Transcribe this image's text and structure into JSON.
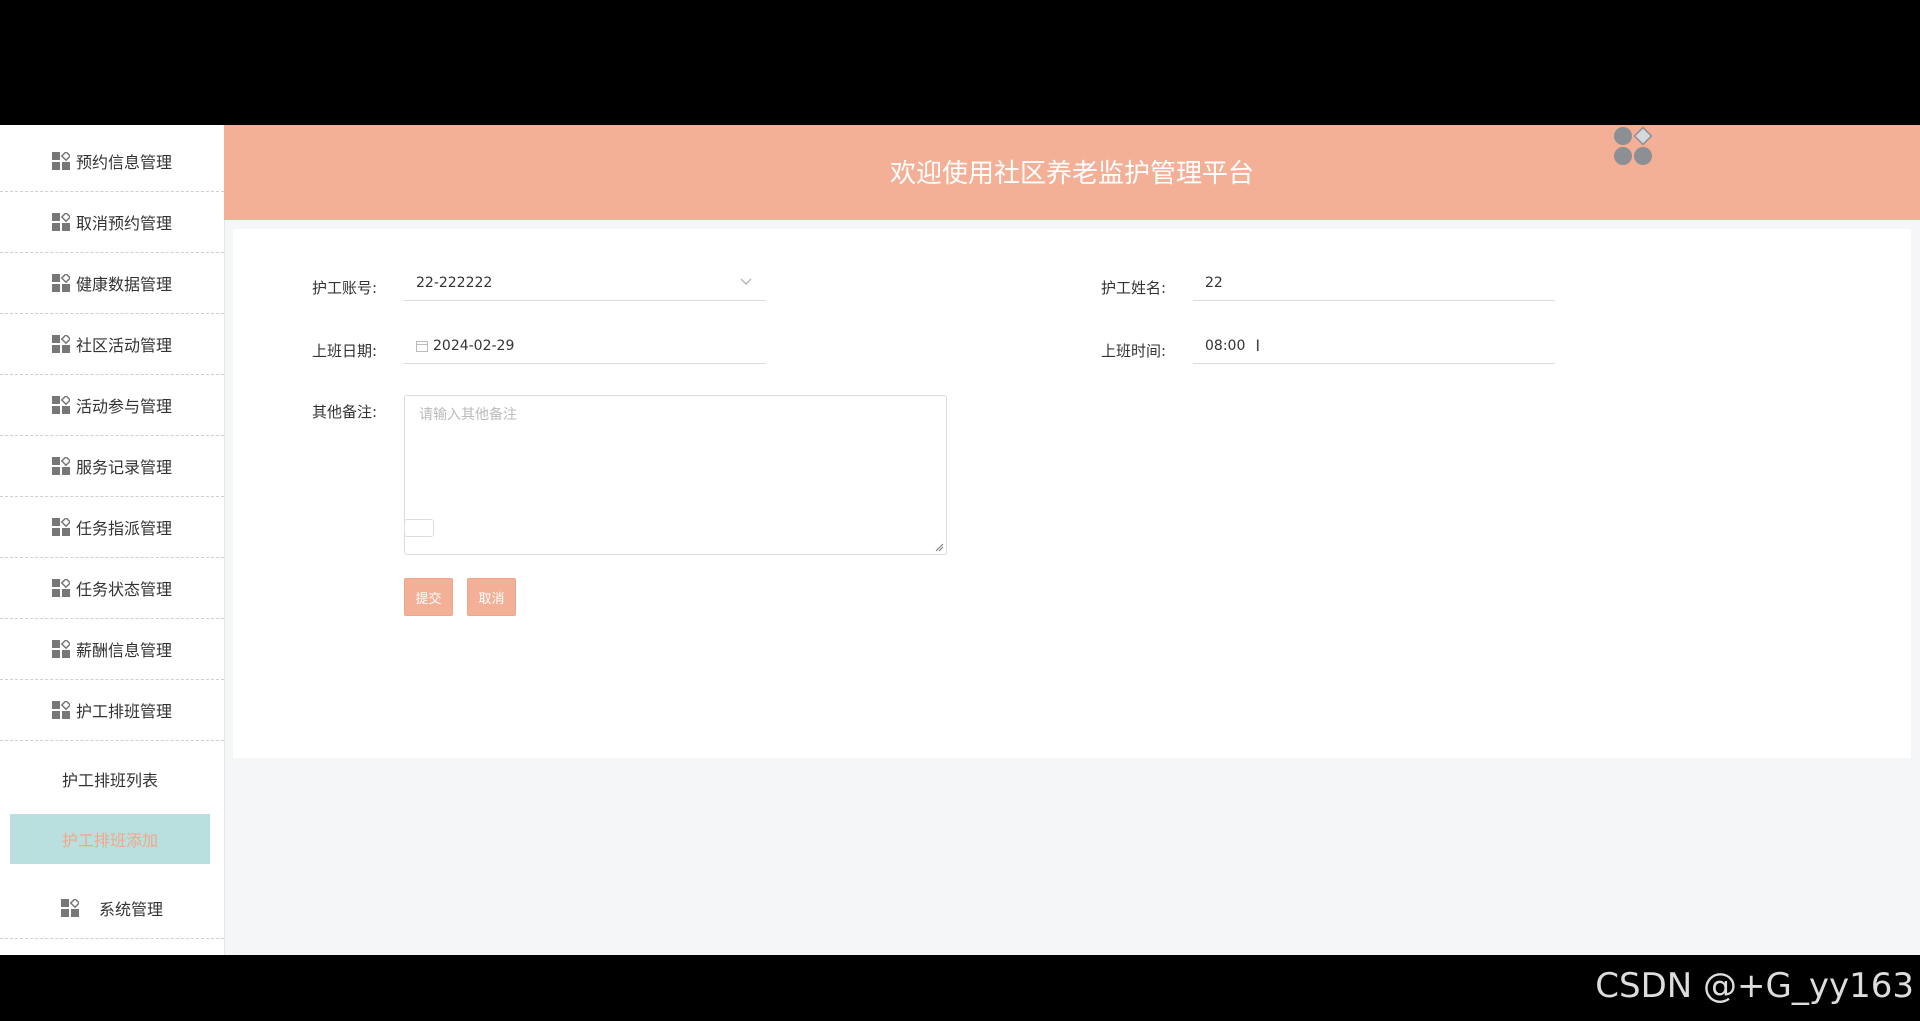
{
  "header": {
    "title": "欢迎使用社区养老监护管理平台"
  },
  "sidebar": {
    "items": [
      {
        "label": "预约信息管理"
      },
      {
        "label": "取消预约管理"
      },
      {
        "label": "健康数据管理"
      },
      {
        "label": "社区活动管理"
      },
      {
        "label": "活动参与管理"
      },
      {
        "label": "服务记录管理"
      },
      {
        "label": "任务指派管理"
      },
      {
        "label": "任务状态管理"
      },
      {
        "label": "薪酬信息管理"
      },
      {
        "label": "护工排班管理"
      }
    ],
    "subitems": [
      {
        "label": "护工排班列表"
      },
      {
        "label": "护工排班添加"
      }
    ],
    "system": {
      "label": "系统管理"
    }
  },
  "form": {
    "account": {
      "label": "护工账号:",
      "value": "22-222222"
    },
    "name": {
      "label": "护工姓名:",
      "value": "22"
    },
    "date": {
      "label": "上班日期:",
      "value": "2024-02-29"
    },
    "time": {
      "label": "上班时间:",
      "value": "08:00"
    },
    "remark": {
      "label": "其他备注:",
      "placeholder": "请输入其他备注"
    },
    "submit": "提交",
    "cancel": "取消"
  },
  "colors": {
    "accent": "#f4b097",
    "active_bg": "#b9e0df"
  },
  "watermark": "CSDN @+G_yy163"
}
